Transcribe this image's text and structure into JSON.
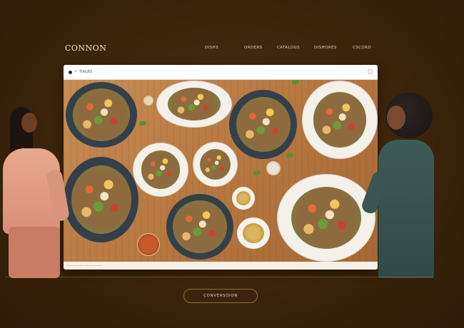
{
  "header": {
    "logo": "CONNON",
    "nav": [
      "DISHS",
      "ORDERS",
      "CATALOGS",
      "DISHORES",
      "CSCORD"
    ]
  },
  "browser": {
    "title": "TIAGRS",
    "close_glyph": "×",
    "footer_text": "—————— ——————"
  },
  "cta": {
    "label": "CONVERSOION"
  },
  "colors": {
    "background": "#3a230a",
    "accent": "#8f6b3b",
    "table_wood": "#b97a43"
  },
  "icons": [
    "close-icon",
    "menu-dot-icon",
    "window-control-icon"
  ]
}
